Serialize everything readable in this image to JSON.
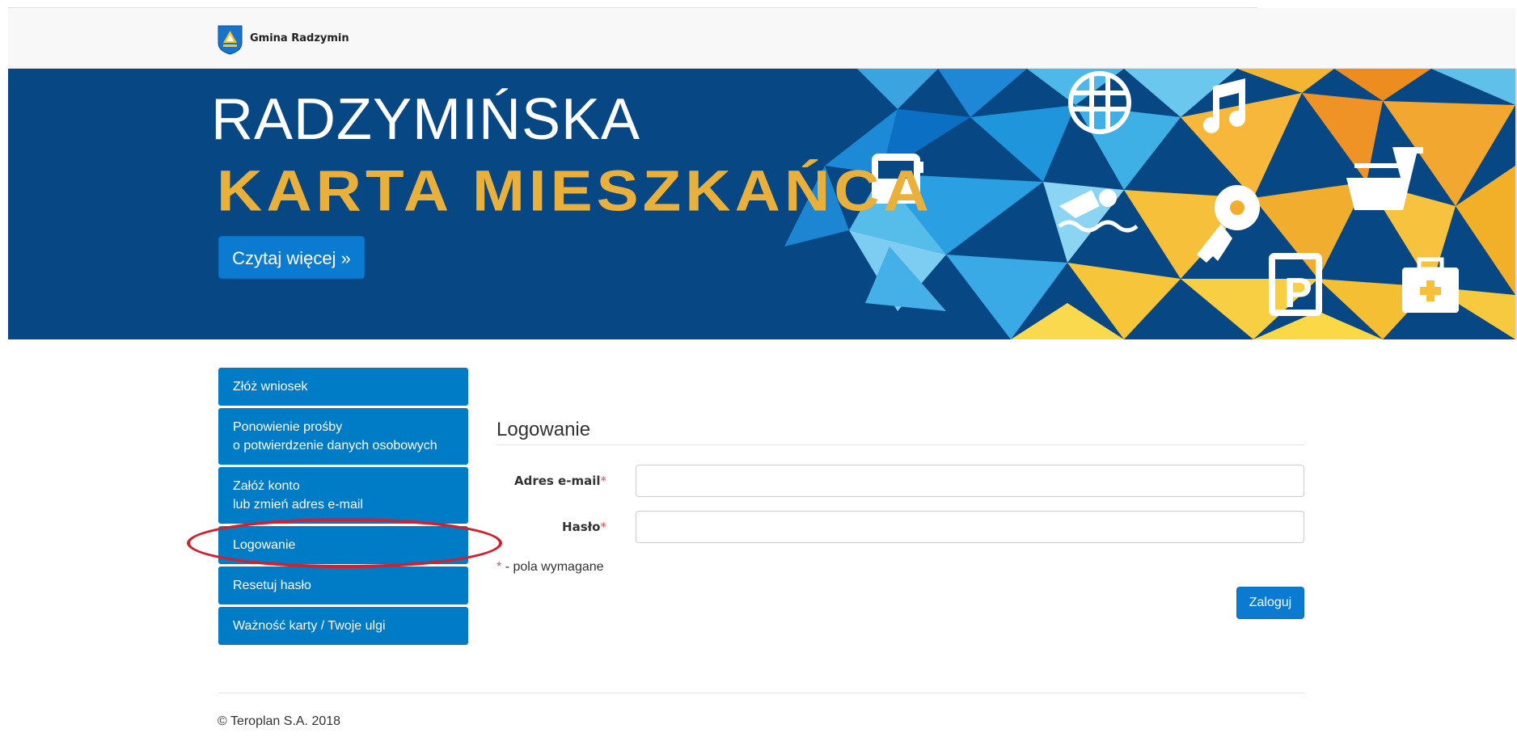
{
  "header": {
    "brand_name": "Gmina Radzymin",
    "logo_icon": "coat-of-arms-icon"
  },
  "hero": {
    "title_line1": "RADZYMIŃSKA",
    "title_line2": "KARTA MIESZKAŃCA",
    "read_more": "Czytaj więcej »",
    "icons": [
      "volleyball-icon",
      "music-note-icon",
      "bus-icon",
      "shopping-cart-icon",
      "swimmer-icon",
      "key-icon",
      "parking-icon",
      "first-aid-icon"
    ],
    "colors": {
      "background": "#074784",
      "title_accent": "#e9b13b",
      "button": "#0a7bd1"
    }
  },
  "sidebar": {
    "items": [
      {
        "label": "Złóż wniosek",
        "sub": ""
      },
      {
        "label": "Ponowienie prośby",
        "sub": "o potwierdzenie danych osobowych"
      },
      {
        "label": "Załóż konto",
        "sub": "lub zmień adres e-mail"
      },
      {
        "label": "Logowanie",
        "sub": ""
      },
      {
        "label": "Resetuj hasło",
        "sub": ""
      },
      {
        "label": "Ważność karty / Twoje ulgi",
        "sub": ""
      }
    ],
    "active_highlight_color": "#d3202e"
  },
  "login": {
    "title": "Logowanie",
    "email_label": "Adres e-mail",
    "password_label": "Hasło",
    "required_mark": "*",
    "email_value": "",
    "password_value": "",
    "required_note": "- pola wymagane",
    "submit": "Zaloguj"
  },
  "footer": {
    "copyright": "© Teroplan S.A. 2018"
  }
}
